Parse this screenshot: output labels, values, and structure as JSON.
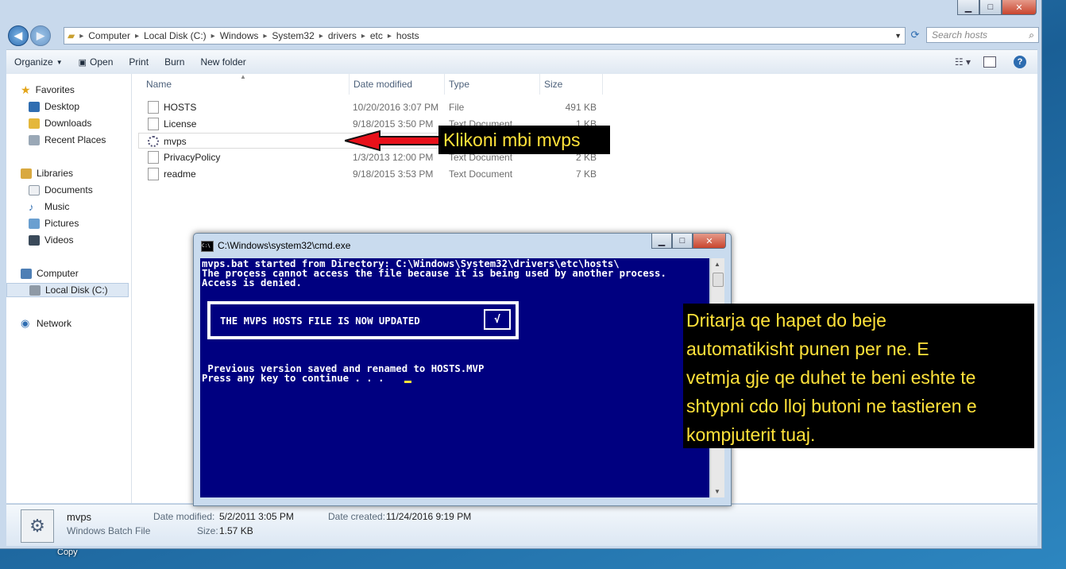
{
  "explorer": {
    "breadcrumb": [
      "Computer",
      "Local Disk (C:)",
      "Windows",
      "System32",
      "drivers",
      "etc",
      "hosts"
    ],
    "search_placeholder": "Search hosts",
    "toolbar": {
      "organize": "Organize",
      "open": "Open",
      "print": "Print",
      "burn": "Burn",
      "new_folder": "New folder"
    },
    "nav": {
      "favorites": "Favorites",
      "desktop": "Desktop",
      "downloads": "Downloads",
      "recent_places": "Recent Places",
      "libraries": "Libraries",
      "documents": "Documents",
      "music": "Music",
      "pictures": "Pictures",
      "videos": "Videos",
      "computer": "Computer",
      "local_disk": "Local Disk (C:)",
      "network": "Network"
    },
    "columns": {
      "name": "Name",
      "date_modified": "Date modified",
      "type": "Type",
      "size": "Size"
    },
    "files": [
      {
        "name": "HOSTS",
        "date": "10/20/2016 3:07 PM",
        "type": "File",
        "size": "491 KB"
      },
      {
        "name": "License",
        "date": "9/18/2015 3:50 PM",
        "type": "Text Document",
        "size": "1 KB"
      },
      {
        "name": "mvps",
        "date": "",
        "type": "",
        "size": ""
      },
      {
        "name": "PrivacyPolicy",
        "date": "1/3/2013 12:00 PM",
        "type": "Text Document",
        "size": "2 KB"
      },
      {
        "name": "readme",
        "date": "9/18/2015 3:53 PM",
        "type": "Text Document",
        "size": "7 KB"
      }
    ],
    "details": {
      "name": "mvps",
      "kind": "Windows Batch File",
      "date_modified_label": "Date modified:",
      "date_modified": "5/2/2011 3:05 PM",
      "size_label": "Size:",
      "size": "1.57 KB",
      "date_created_label": "Date created:",
      "date_created": "11/24/2016 9:19 PM"
    }
  },
  "desktop": {
    "copy_label": "Copy"
  },
  "cmd": {
    "title": "C:\\Windows\\system32\\cmd.exe",
    "lines": [
      "mvps.bat started from Directory: C:\\Windows\\System32\\drivers\\etc\\hosts\\",
      "The process cannot access the file because it is being used by another process.",
      "Access is denied."
    ],
    "banner": "THE MVPS HOSTS FILE IS NOW UPDATED",
    "check": "√",
    "after_lines": [
      " Previous version saved and renamed to HOSTS.MVP",
      "Press any key to continue . . ."
    ]
  },
  "annotations": {
    "click_note": "Klikoni mbi mvps",
    "window_note": [
      "Dritarja qe hapet do beje",
      "automatikisht punen per ne. E",
      "vetmja gje qe duhet te beni eshte te",
      "shtypni cdo lloj butoni ne tastieren e",
      "kompjuterit tuaj."
    ],
    "color": "#ffe23a"
  }
}
